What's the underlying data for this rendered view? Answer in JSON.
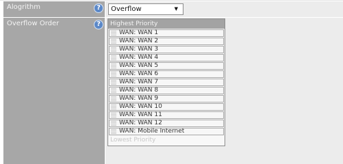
{
  "algorithm": {
    "label": "Alogrithm",
    "help": "?",
    "select_value": "Overflow",
    "select_arrow": "▼"
  },
  "overflow_order": {
    "label": "Overflow Order",
    "help": "?",
    "header": "Highest Priority",
    "footer": "Lowest Priority",
    "items": [
      "WAN: WAN 1",
      "WAN: WAN 2",
      "WAN: WAN 3",
      "WAN: WAN 4",
      "WAN: WAN 5",
      "WAN: WAN 6",
      "WAN: WAN 7",
      "WAN: WAN 8",
      "WAN: WAN 9",
      "WAN: WAN 10",
      "WAN: WAN 11",
      "WAN: WAN 12",
      "WAN: Mobile Internet"
    ]
  }
}
